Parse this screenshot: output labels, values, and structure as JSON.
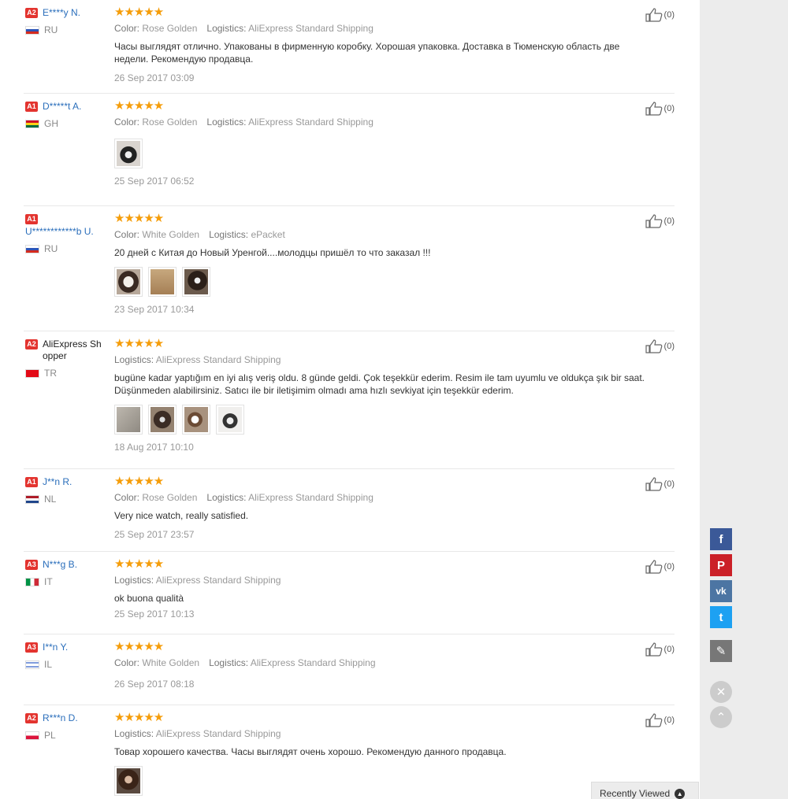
{
  "reviews": [
    {
      "level": "A2",
      "name": "E****y N.",
      "country": "RU",
      "stars": "★★★★★",
      "color_label": "Color:",
      "color": "Rose Golden",
      "logistics_label": "Logistics:",
      "logistics": "AliExpress Standard Shipping",
      "text": "Часы выглядят отлично. Упакованы в фирменную коробку. Хорошая упаковка. Доставка в Тюменскую область две недели. Рекомендую продавца.",
      "date": "26 Sep 2017 03:09",
      "likes": "(0)"
    },
    {
      "level": "A1",
      "name": "D*****t A.",
      "country": "GH",
      "stars": "★★★★★",
      "color_label": "Color:",
      "color": "Rose Golden",
      "logistics_label": "Logistics:",
      "logistics": "AliExpress Standard Shipping",
      "text": "",
      "date": "25 Sep 2017 06:52",
      "likes": "(0)"
    },
    {
      "level": "A1",
      "name": "U************b U.",
      "country": "RU",
      "stars": "★★★★★",
      "color_label": "Color:",
      "color": "White Golden",
      "logistics_label": "Logistics:",
      "logistics": "ePacket",
      "text": "20 дней с Китая до Новый Уренгой....молодцы пришёл то что заказал !!!",
      "date": "23 Sep 2017 10:34",
      "likes": "(0)"
    },
    {
      "level": "A2",
      "name": "AliExpress Shopper",
      "country": "TR",
      "stars": "★★★★★",
      "color_label": "",
      "color": "",
      "logistics_label": "Logistics:",
      "logistics": "AliExpress Standard Shipping",
      "text": "bugüne kadar yaptığım en iyi alış veriş oldu. 8 günde geldi. Çok teşekkür ederim. Resim ile tam uyumlu ve oldukça şık bir saat. Düşünmeden alabilirsiniz. Satıcı ile bir iletişimim olmadı ama hızlı sevkiyat için teşekkür ederim.",
      "date": "18 Aug 2017 10:10",
      "likes": "(0)"
    },
    {
      "level": "A1",
      "name": "J**n R.",
      "country": "NL",
      "stars": "★★★★★",
      "color_label": "Color:",
      "color": "Rose Golden",
      "logistics_label": "Logistics:",
      "logistics": "AliExpress Standard Shipping",
      "text": "Very nice watch, really satisfied.",
      "date": "25 Sep 2017 23:57",
      "likes": "(0)"
    },
    {
      "level": "A3",
      "name": "N***g B.",
      "country": "IT",
      "stars": "★★★★★",
      "color_label": "",
      "color": "",
      "logistics_label": "Logistics:",
      "logistics": "AliExpress Standard Shipping",
      "text": "ok buona qualità",
      "date": "25 Sep 2017 10:13",
      "likes": "(0)"
    },
    {
      "level": "A3",
      "name": "I**n Y.",
      "country": "IL",
      "stars": "★★★★★",
      "color_label": "Color:",
      "color": "White Golden",
      "logistics_label": "Logistics:",
      "logistics": "AliExpress Standard Shipping",
      "text": "",
      "date": "26 Sep 2017 08:18",
      "likes": "(0)"
    },
    {
      "level": "A2",
      "name": "R***n D.",
      "country": "PL",
      "stars": "★★★★★",
      "color_label": "",
      "color": "",
      "logistics_label": "Logistics:",
      "logistics": "AliExpress Standard Shipping",
      "text": "Товар хорошего качества. Часы выглядят очень хорошо. Рекомендую данного продавца.",
      "date": "",
      "likes": "(0)"
    }
  ],
  "social": {
    "facebook": "f",
    "pinterest": "P",
    "vk": "vk",
    "twitter": "t",
    "edit": "✎",
    "close": "✕",
    "up": "⌃"
  },
  "recently_viewed": "Recently Viewed",
  "colors": {
    "star": "#f59d0a",
    "level_badge": "#e3342f",
    "username": "#2a6ebb",
    "facebook": "#3b5998",
    "pinterest": "#cb2027",
    "vk": "#4c75a3",
    "twitter": "#1da1f2"
  }
}
